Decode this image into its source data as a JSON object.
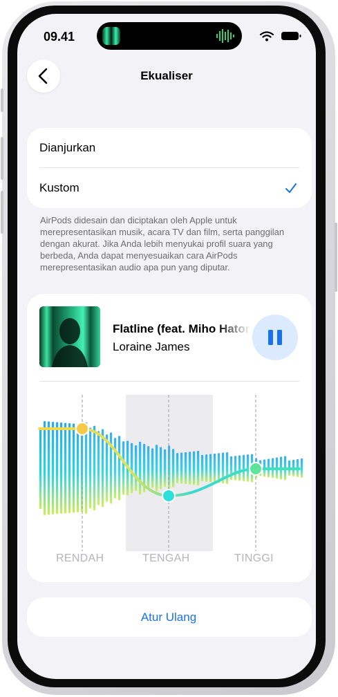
{
  "status_bar": {
    "time": "09.41",
    "wifi_icon": "wifi-icon",
    "battery_icon": "battery-icon"
  },
  "nav": {
    "title": "Ekualiser",
    "back_icon": "chevron-left-icon"
  },
  "options": {
    "items": [
      {
        "label": "Dianjurkan",
        "selected": false
      },
      {
        "label": "Kustom",
        "selected": true
      }
    ],
    "check_icon": "checkmark-icon"
  },
  "description": "AirPods didesain dan diciptakan oleh Apple untuk merepresentasikan musik, acara TV dan film, serta panggilan dengan akurat. Jika Anda lebih menyukai profil suara yang berbeda, Anda dapat menyesuaikan cara AirPods merepresentasikan audio apa pun yang diputar.",
  "now_playing": {
    "title": "Flatline (feat. Miho Hatori)",
    "artist": "Loraine James",
    "pause_icon": "pause-icon"
  },
  "equalizer": {
    "bands": [
      {
        "label": "RENDAH",
        "handle_color": "#f7c948"
      },
      {
        "label": "TENGAH",
        "handle_color": "#2ee0d8"
      },
      {
        "label": "TINGGI",
        "handle_color": "#5ee39a"
      }
    ],
    "colors": {
      "low": "#f0e35a",
      "mid": "#19d3e6",
      "high": "#1aa6f2",
      "curve_warm": "#f7d64a",
      "curve_cool": "#3ad8d0"
    }
  },
  "reset": {
    "label": "Atur Ulang"
  },
  "colors": {
    "accent": "#1a73e8",
    "background": "#f2f2f7",
    "card": "#ffffff"
  }
}
